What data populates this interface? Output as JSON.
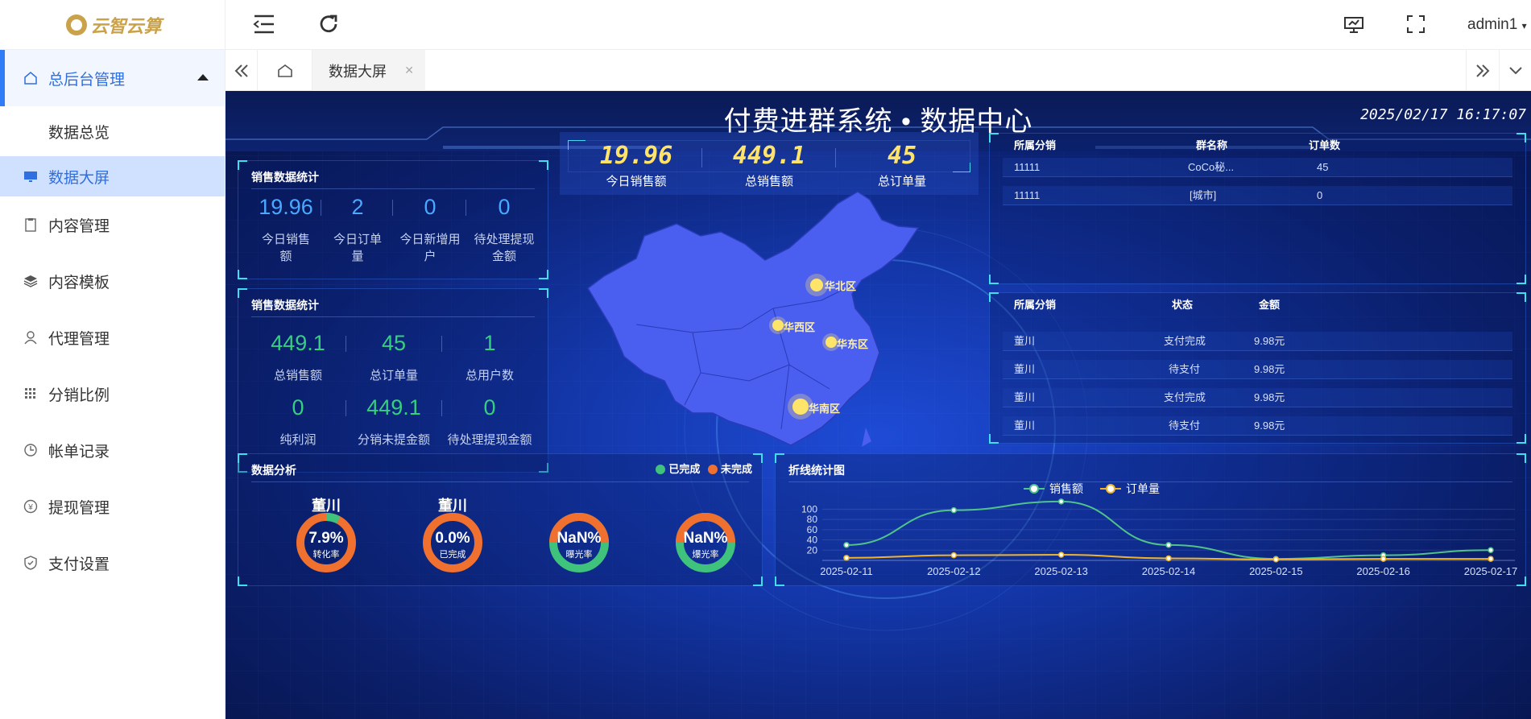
{
  "sidebar": {
    "logo": "云智云算",
    "items": [
      {
        "label": "总后台管理",
        "icon": "home-icon"
      },
      {
        "label": "数据总览"
      },
      {
        "label": "数据大屏",
        "icon": "monitor-icon"
      },
      {
        "label": "内容管理",
        "icon": "clipboard-icon"
      },
      {
        "label": "内容模板",
        "icon": "layers-icon"
      },
      {
        "label": "代理管理",
        "icon": "user-icon"
      },
      {
        "label": "分销比例",
        "icon": "grid-icon"
      },
      {
        "label": "帐单记录",
        "icon": "clock-icon"
      },
      {
        "label": "提现管理",
        "icon": "yen-icon"
      },
      {
        "label": "支付设置",
        "icon": "shield-icon"
      }
    ]
  },
  "topbar": {
    "user": "admin1"
  },
  "tabs": {
    "active": "数据大屏"
  },
  "screen": {
    "title": "付费进群系统 • 数据中心",
    "time": "2025/02/17 16:17:07"
  },
  "panel1": {
    "title": "销售数据统计",
    "stats": [
      {
        "value": "19.96",
        "label": "今日销售额"
      },
      {
        "value": "2",
        "label": "今日订单量"
      },
      {
        "value": "0",
        "label": "今日新增用户"
      },
      {
        "value": "0",
        "label": "待处理提现金额"
      }
    ]
  },
  "panel2": {
    "title": "销售数据统计",
    "stats": [
      {
        "value": "449.1",
        "label": "总销售额"
      },
      {
        "value": "45",
        "label": "总订单量"
      },
      {
        "value": "1",
        "label": "总用户数"
      },
      {
        "value": "0",
        "label": "纯利润"
      },
      {
        "value": "449.1",
        "label": "分销未提金额"
      },
      {
        "value": "0",
        "label": "待处理提现金额"
      }
    ]
  },
  "center": {
    "stats": [
      {
        "value": "19.96",
        "label": "今日销售额"
      },
      {
        "value": "449.1",
        "label": "总销售额"
      },
      {
        "value": "45",
        "label": "总订单量"
      }
    ],
    "regions": [
      "华北区",
      "华西区",
      "华东区",
      "华南区"
    ]
  },
  "table1": {
    "headers": [
      "所属分销",
      "群名称",
      "订单数"
    ],
    "rows": [
      [
        "11111",
        "CoCo秘...",
        "45"
      ],
      [
        "11111",
        "[城市]",
        "0"
      ]
    ]
  },
  "table2": {
    "headers": [
      "所属分销",
      "状态",
      "金额"
    ],
    "rows": [
      [
        "董川",
        "支付完成",
        "9.98元"
      ],
      [
        "董川",
        "待支付",
        "9.98元"
      ],
      [
        "董川",
        "支付完成",
        "9.98元"
      ],
      [
        "董川",
        "待支付",
        "9.98元"
      ]
    ]
  },
  "analysis": {
    "title": "数据分析",
    "legend": [
      {
        "label": "已完成",
        "color": "#3ec27c"
      },
      {
        "label": "未完成",
        "color": "#f07030"
      }
    ],
    "rings": [
      {
        "name": "董川",
        "value": "7.9%",
        "label": "转化率",
        "pct": 7.9
      },
      {
        "name": "董川",
        "value": "0.0%",
        "label": "已完成",
        "pct": 0
      },
      {
        "name": "",
        "value": "NaN%",
        "label": "曝光率",
        "pct": null
      },
      {
        "name": "",
        "value": "NaN%",
        "label": "爆光率",
        "pct": null
      }
    ]
  },
  "chart_title": "折线统计图",
  "chart_data": {
    "type": "line",
    "categories": [
      "2025-02-11",
      "2025-02-12",
      "2025-02-13",
      "2025-02-14",
      "2025-02-15",
      "2025-02-16",
      "2025-02-17"
    ],
    "series": [
      {
        "name": "销售额",
        "color": "#4fc38a",
        "values": [
          30,
          98,
          115,
          30,
          3,
          10,
          20
        ]
      },
      {
        "name": "订单量",
        "color": "#f0b429",
        "values": [
          5,
          10,
          11,
          4,
          2,
          3,
          3
        ]
      }
    ],
    "ylim": [
      0,
      110
    ],
    "yticks": [
      20,
      40,
      60,
      80,
      100
    ]
  }
}
